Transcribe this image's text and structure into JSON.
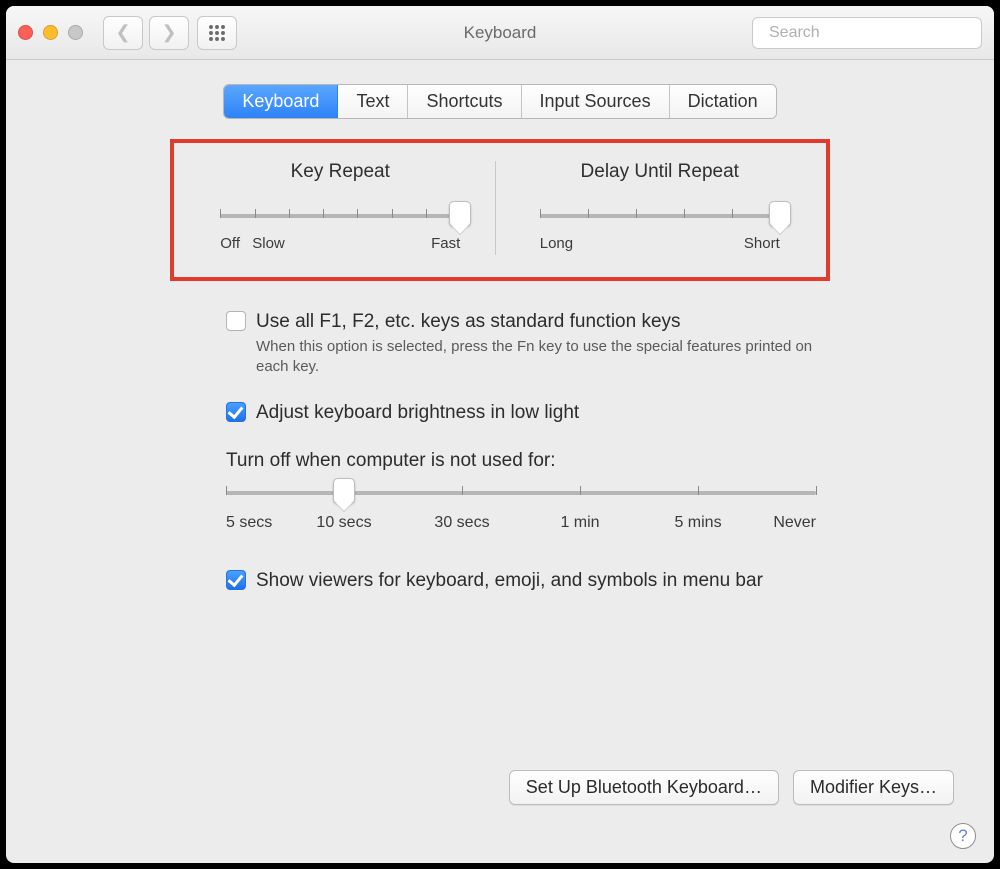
{
  "window": {
    "title": "Keyboard"
  },
  "toolbar": {
    "search_placeholder": "Search"
  },
  "tabs": [
    {
      "label": "Keyboard",
      "active": true
    },
    {
      "label": "Text",
      "active": false
    },
    {
      "label": "Shortcuts",
      "active": false
    },
    {
      "label": "Input Sources",
      "active": false
    },
    {
      "label": "Dictation",
      "active": false
    }
  ],
  "sliders": {
    "key_repeat": {
      "title": "Key Repeat",
      "labels_left": "Off",
      "labels_left2": "Slow",
      "labels_right": "Fast",
      "stops": 8,
      "value_index": 7
    },
    "delay_until_repeat": {
      "title": "Delay Until Repeat",
      "labels_left": "Long",
      "labels_right": "Short",
      "stops": 6,
      "value_index": 5
    },
    "backlight_off": {
      "title": "Turn off when computer is not used for:",
      "labels": [
        "5 secs",
        "10 secs",
        "30 secs",
        "1 min",
        "5 mins",
        "Never"
      ],
      "stops": 6,
      "value_index": 1
    }
  },
  "options": {
    "fn_keys": {
      "checked": false,
      "label": "Use all F1, F2, etc. keys as standard function keys",
      "desc": "When this option is selected, press the Fn key to use the special features printed on each key."
    },
    "auto_brightness": {
      "checked": true,
      "label": "Adjust keyboard brightness in low light"
    },
    "show_viewers": {
      "checked": true,
      "label": "Show viewers for keyboard, emoji, and symbols in menu bar"
    }
  },
  "buttons": {
    "bluetooth": "Set Up Bluetooth Keyboard…",
    "modifier": "Modifier Keys…"
  },
  "help": "?"
}
